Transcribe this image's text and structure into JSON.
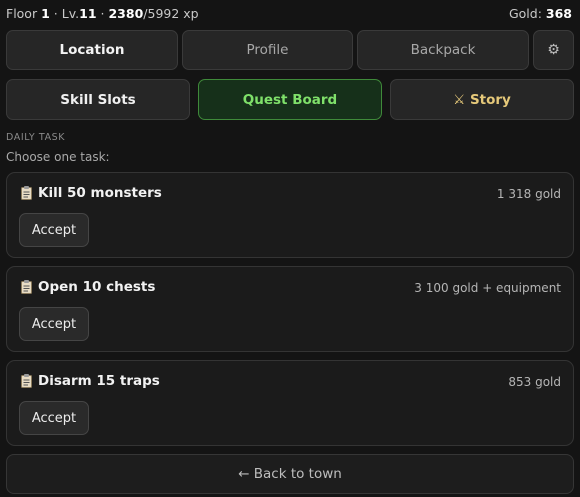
{
  "status": {
    "floor_label": "Floor",
    "floor": "1",
    "sep1": "·",
    "lv_label": "Lv.",
    "level": "11",
    "sep2": "·",
    "xp": "2380",
    "xp_max": "/5992 xp",
    "gold_label": "Gold:",
    "gold": "368"
  },
  "tabs_row1": [
    "Location",
    "Profile",
    "Backpack"
  ],
  "settings_icon": "⚙",
  "tabs_row2": [
    "Skill Slots",
    "Quest Board",
    "⚔ Story"
  ],
  "section_label": "DAILY TASK",
  "hint": "Choose one task:",
  "tasks": [
    {
      "title": "Kill 50 monsters",
      "reward": "1 318 gold",
      "action": "Accept"
    },
    {
      "title": "Open 10 chests",
      "reward": "3 100 gold + equipment",
      "action": "Accept"
    },
    {
      "title": "Disarm 15 traps",
      "reward": "853 gold",
      "action": "Accept"
    }
  ],
  "back_label": "← Back to town",
  "colors": {
    "background": "#141414",
    "quest_accent": "#7fe06a",
    "story_accent": "#e6c97a"
  }
}
